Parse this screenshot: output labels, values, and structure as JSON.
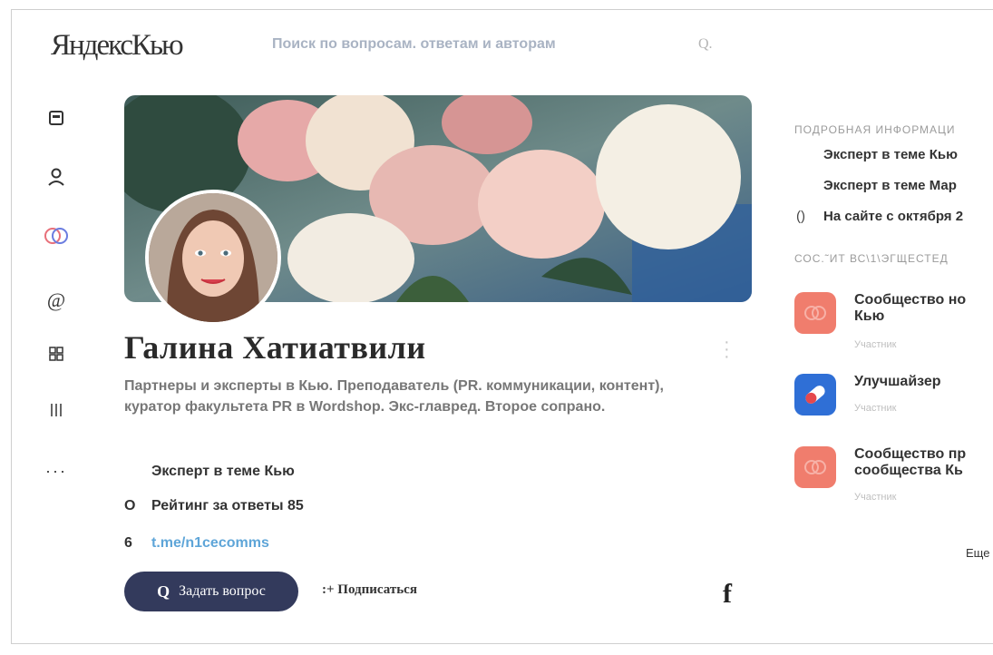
{
  "header": {
    "logo": "ЯндексКью",
    "search_placeholder": "Поиск по вопросам. ответам и авторам",
    "search_icon": "Q."
  },
  "sidebar": {
    "items": [
      {
        "icon": "feed-icon"
      },
      {
        "icon": "profile-icon"
      },
      {
        "icon": "communities-icon"
      },
      {
        "icon": "at-icon"
      },
      {
        "icon": "grid-icon"
      },
      {
        "icon": "stats-icon"
      },
      {
        "icon": "more-icon"
      }
    ]
  },
  "profile": {
    "name": "Галина Хатиатвили",
    "bio": "Партнеры и эксперты в Кью. Преподаватель (PR. коммуникации, контент), куратор факультета PR в Wordshop. Экс-главред. Второе сопрано.",
    "expert_label": "Эксперт в теме",
    "expert_topic": "Кью",
    "rating_icon": "O",
    "rating_label": "Рейтинг за ответы",
    "rating_value": "85",
    "link_icon": "6",
    "link": "t.me/n1cecomms",
    "ask_icon": "Q",
    "ask_button": "Задать вопрос",
    "subscribe_icon": ":+",
    "subscribe_button": "Подписаться",
    "facebook_letter": "f"
  },
  "info_panel": {
    "title": "ПОДРОБНАЯ ИНФОРМАЦИ",
    "items": [
      {
        "text": "Эксперт в теме Кью"
      },
      {
        "text": "Эксперт в теме Мар"
      },
      {
        "icon": "()",
        "text": "На сайте с октября 2"
      }
    ]
  },
  "communities": {
    "title": "СОС.˜ИТ ВС\\1\\ЭГЩЕСТЕД",
    "items": [
      {
        "name_line1": "Сообщество но",
        "name_line2": "Кью",
        "role": "Участник",
        "color": "#f07d6d"
      },
      {
        "name_line1": "Улучшайзер",
        "name_line2": "",
        "role": "Участник",
        "color": "#2f6fd6"
      },
      {
        "name_line1": "Сообщество пр",
        "name_line2": "сообщества Кь",
        "role": "Участник",
        "color": "#f07d6d"
      }
    ],
    "more": "Еще"
  }
}
